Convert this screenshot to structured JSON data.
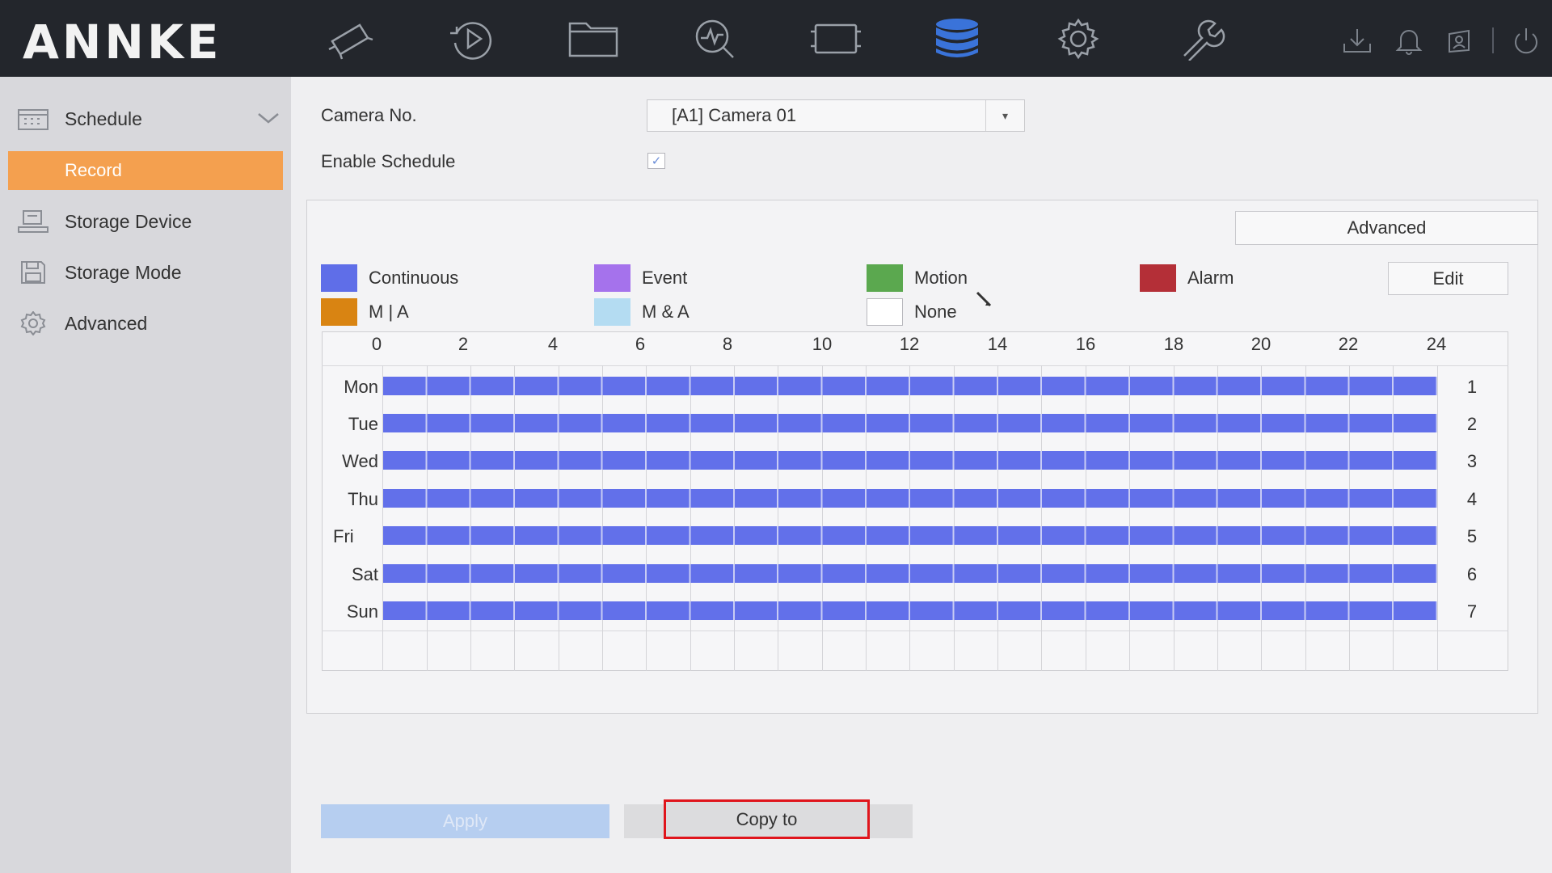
{
  "brand": {
    "logo_text": "ANNKE"
  },
  "topnav": [
    {
      "icon": "camera-icon"
    },
    {
      "icon": "playback-icon"
    },
    {
      "icon": "folder-icon"
    },
    {
      "icon": "search-analytics-icon"
    },
    {
      "icon": "display-icon"
    },
    {
      "icon": "storage-database-icon",
      "active": true
    },
    {
      "icon": "gear-icon"
    },
    {
      "icon": "wrench-icon"
    }
  ],
  "utility_icons": [
    "download-icon",
    "bell-icon",
    "user-lock-icon",
    "power-icon"
  ],
  "sidebar": {
    "items": [
      {
        "label": "Schedule",
        "icon": "calendar-icon",
        "expanded": true
      },
      {
        "label": "Record",
        "selected": true
      },
      {
        "label": "Storage Device",
        "icon": "hdd-icon"
      },
      {
        "label": "Storage Mode",
        "icon": "floppy-icon"
      },
      {
        "label": "Advanced",
        "icon": "gear-icon"
      }
    ]
  },
  "form": {
    "camera_no_label": "Camera No.",
    "camera_value": "[A1] Camera 01",
    "enable_schedule_label": "Enable Schedule",
    "enable_schedule_checked": true,
    "check_mark": "✓"
  },
  "buttons": {
    "advanced": "Advanced",
    "edit": "Edit",
    "apply": "Apply",
    "copy_to": "Copy to"
  },
  "legend": [
    {
      "label": "Continuous",
      "color": "#5f6ee8"
    },
    {
      "label": "Event",
      "color": "#a572ec"
    },
    {
      "label": "Motion",
      "color": "#5ba84f"
    },
    {
      "label": "Alarm",
      "color": "#b42f37"
    },
    {
      "label": "M | A",
      "color": "#d98412"
    },
    {
      "label": "M & A",
      "color": "#b4dcf2"
    },
    {
      "label": "None",
      "color": "#ffffff"
    }
  ],
  "schedule": {
    "hour_labels": [
      "0",
      "2",
      "4",
      "6",
      "8",
      "10",
      "12",
      "14",
      "16",
      "18",
      "20",
      "22",
      "24"
    ],
    "days": [
      "Mon",
      "Tue",
      "Wed",
      "Thu",
      "Fri",
      "Sat",
      "Sun"
    ],
    "row_numbers": [
      "1",
      "2",
      "3",
      "4",
      "5",
      "6",
      "7"
    ],
    "mode_all_day": "Continuous",
    "coverage_hours": [
      0,
      24
    ]
  },
  "colors": {
    "accent_selected": "#f4a04f",
    "schedule_bar": "#6270ea",
    "highlight_border": "#e0151c",
    "active_icon": "#3a73d9"
  }
}
